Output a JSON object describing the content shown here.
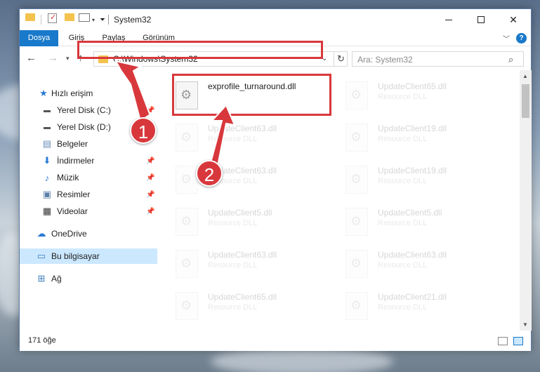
{
  "window": {
    "title": "System32"
  },
  "ribbon": {
    "tabs": [
      {
        "label": "Dosya"
      },
      {
        "label": "Giriş"
      },
      {
        "label": "Paylaş"
      },
      {
        "label": "Görünüm"
      }
    ],
    "help": "?"
  },
  "address": {
    "path": "C:\\Windows\\System32",
    "search_placeholder": "Ara: System32"
  },
  "nav": {
    "items": [
      {
        "label": "Hızlı erişim",
        "icon": "star-icon"
      },
      {
        "label": "Yerel Disk (C:)",
        "icon": "drive-icon"
      },
      {
        "label": "Yerel Disk (D:)",
        "icon": "drive-icon"
      },
      {
        "label": "Belgeler",
        "icon": "document-icon"
      },
      {
        "label": "İndirmeler",
        "icon": "download-icon"
      },
      {
        "label": "Müzik",
        "icon": "music-icon"
      },
      {
        "label": "Resimler",
        "icon": "pictures-icon"
      },
      {
        "label": "Videolar",
        "icon": "video-icon"
      },
      {
        "label": "OneDrive",
        "icon": "cloud-icon"
      },
      {
        "label": "Bu bilgisayar",
        "icon": "computer-icon"
      },
      {
        "label": "Ağ",
        "icon": "network-icon"
      }
    ]
  },
  "files": [
    {
      "name": "exprofile_turnaround.dll",
      "type": "",
      "highlight": true
    },
    {
      "name": "UpdateClient65.dll",
      "type": "Resource DLL"
    },
    {
      "name": "UpdateClient63.dll",
      "type": "Resource DLL"
    },
    {
      "name": "UpdateClient19.dll",
      "type": "Resource DLL"
    },
    {
      "name": "UpdateClient63.dll",
      "type": "Resource DLL"
    },
    {
      "name": "UpdateClient19.dll",
      "type": "Resource DLL"
    },
    {
      "name": "UpdateClient5.dll",
      "type": "Resource DLL"
    },
    {
      "name": "UpdateClient5.dll",
      "type": "Resource DLL"
    },
    {
      "name": "UpdateClient63.dll",
      "type": "Resource DLL"
    },
    {
      "name": "UpdateClient63.dll",
      "type": "Resource DLL"
    },
    {
      "name": "UpdateClient65.dll",
      "type": "Resource DLL"
    },
    {
      "name": "UpdateClient21.dll",
      "type": "Resource DLL"
    }
  ],
  "status": {
    "count": "171 öğe"
  },
  "annotations": {
    "step1": "1",
    "step2": "2"
  },
  "colors": {
    "accent": "#1979ca",
    "highlight_box": "#d8383c",
    "selected_nav": "#cce8ff"
  }
}
